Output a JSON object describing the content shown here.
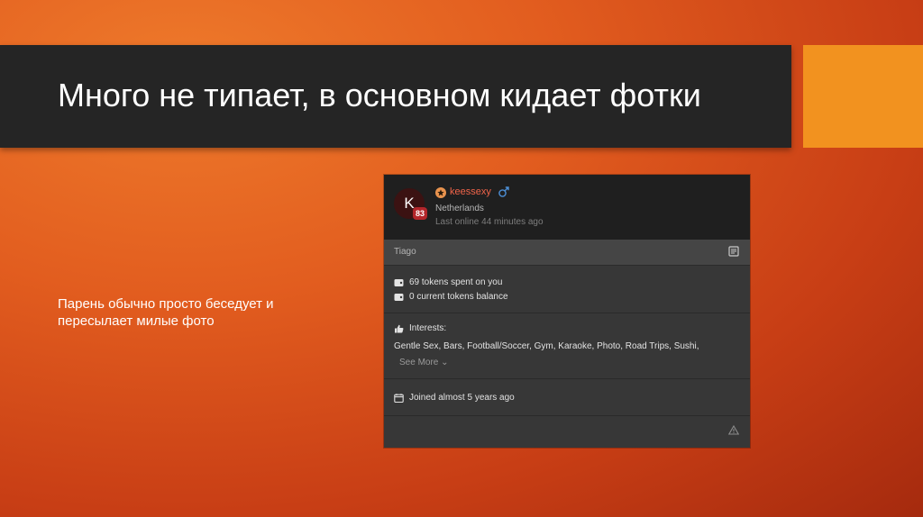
{
  "slide": {
    "title": "Много не типает, в основном кидает фотки",
    "body": "Парень обычно просто беседует и пересылает милые фото"
  },
  "profile": {
    "avatar_letter": "K",
    "level": "83",
    "username": "keessexy",
    "gender_symbol": "♂",
    "country": "Netherlands",
    "last_online": "Last online 44 minutes ago"
  },
  "notes": {
    "name": "Tiago"
  },
  "stats": {
    "tokens_spent": "69 tokens spent on you",
    "tokens_balance": "0 current tokens balance"
  },
  "interests": {
    "label": "Interests:",
    "list": "Gentle Sex, Bars, Football/Soccer, Gym, Karaoke, Photo, Road Trips, Sushi,",
    "see_more": "See More"
  },
  "joined": "Joined almost 5 years ago",
  "colors": {
    "title_band": "#252525",
    "accent": "#f2921f",
    "username": "#f0644a",
    "level_badge": "#b3262b"
  }
}
